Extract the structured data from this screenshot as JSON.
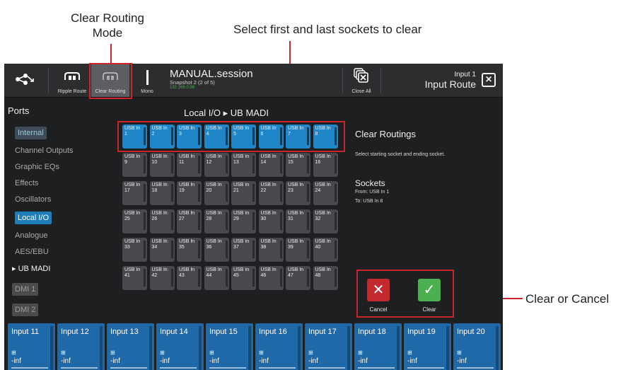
{
  "annotations": {
    "clear_mode_line1": "Clear Routing",
    "clear_mode_line2": "Mode",
    "select_sockets": "Select first and last sockets to clear",
    "clear_cancel": "Clear or Cancel"
  },
  "topbar": {
    "ripple_label": "Ripple Route",
    "clear_routing_label": "Clear Routing",
    "mono_label": "Mono",
    "session_name": "MANUAL.session",
    "snapshot": "Snapshot 2 (2 of 5)",
    "ip": "192.168.0.98",
    "close_all_label": "Close All",
    "route_channel": "Input 1",
    "route_title": "Input Route"
  },
  "ports": {
    "title": "Ports",
    "internal": "Internal",
    "channel_outputs": "Channel Outputs",
    "graphic_eqs": "Graphic EQs",
    "effects": "Effects",
    "oscillators": "Oscillators",
    "local_io": "Local I/O",
    "analogue": "Analogue",
    "aes_ebu": "AES/EBU",
    "ub_madi": "▸ UB MADI",
    "dmi1": "DMI 1",
    "dmi2": "DMI 2"
  },
  "grid": {
    "title": "Local I/O ▸ UB MADI",
    "socket_prefix": "USB In",
    "selected_range": [
      1,
      8
    ],
    "count": 48
  },
  "info": {
    "title": "Clear Routings",
    "description": "Select starting socket and ending socket.",
    "sockets_title": "Sockets",
    "from": "From: USB In 1",
    "to": "To: USB In 8",
    "cancel_label": "Cancel",
    "clear_label": "Clear"
  },
  "strips": [
    {
      "name": "Input 11",
      "value": "-inf"
    },
    {
      "name": "Input 12",
      "value": "-inf"
    },
    {
      "name": "Input 13",
      "value": "-inf"
    },
    {
      "name": "Input 14",
      "value": "-inf"
    },
    {
      "name": "Input 15",
      "value": "-inf"
    },
    {
      "name": "Input 16",
      "value": "-inf"
    },
    {
      "name": "Input 17",
      "value": "-inf"
    },
    {
      "name": "Input 18",
      "value": "-inf"
    },
    {
      "name": "Input 19",
      "value": "-inf"
    },
    {
      "name": "Input 20",
      "value": "-inf"
    }
  ],
  "colors": {
    "highlight": "#c8262b",
    "selected_socket": "#1f86c7",
    "strip": "#1f69a8",
    "cancel": "#c32a2f",
    "clear": "#4caf50"
  }
}
